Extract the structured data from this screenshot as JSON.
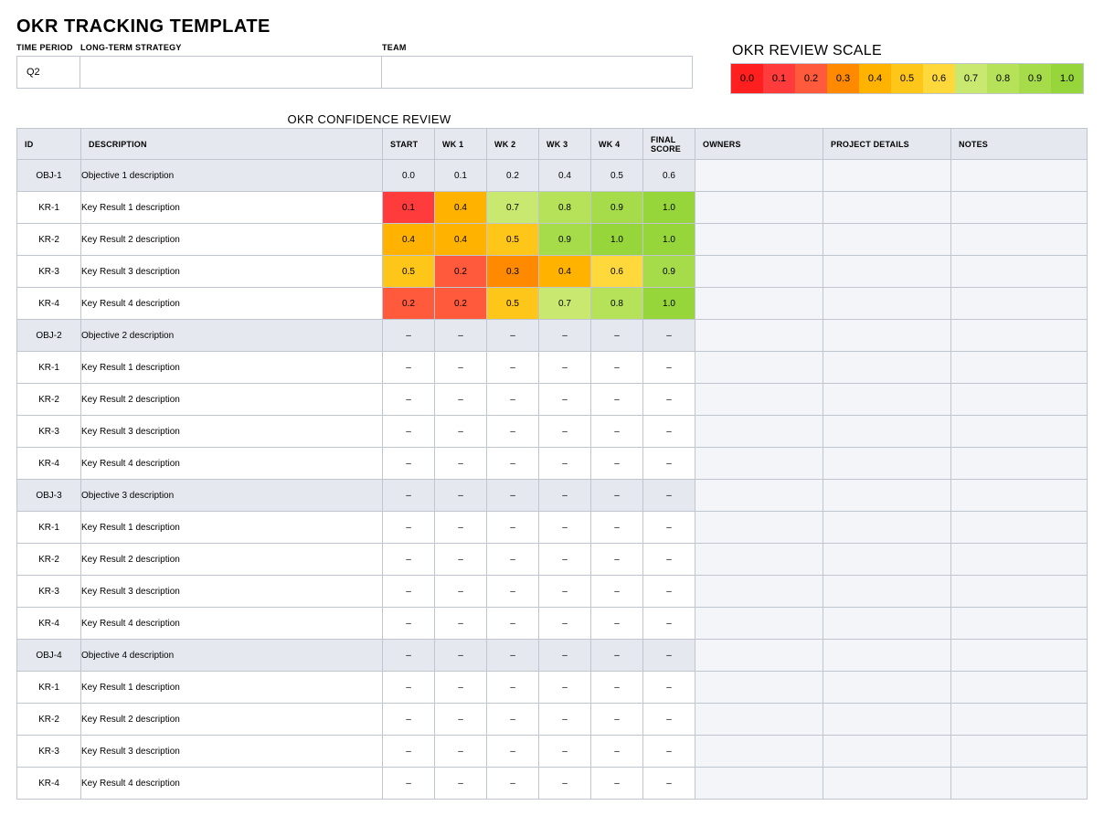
{
  "title": "OKR TRACKING TEMPLATE",
  "meta": {
    "time_period_label": "TIME PERIOD",
    "time_period_value": "Q2",
    "long_term_label": "LONG-TERM STRATEGY",
    "long_term_value": "",
    "team_label": "TEAM",
    "team_value": ""
  },
  "scale": {
    "title": "OKR REVIEW SCALE",
    "cells": [
      "0.0",
      "0.1",
      "0.2",
      "0.3",
      "0.4",
      "0.5",
      "0.6",
      "0.7",
      "0.8",
      "0.9",
      "1.0"
    ]
  },
  "review_title": "OKR CONFIDENCE REVIEW",
  "columns": {
    "id": "ID",
    "description": "DESCRIPTION",
    "start": "START",
    "wk1": "WK 1",
    "wk2": "WK 2",
    "wk3": "WK 3",
    "wk4": "WK 4",
    "final": "FINAL SCORE",
    "owners": "OWNERS",
    "project": "PROJECT DETAILS",
    "notes": "NOTES"
  },
  "rows": [
    {
      "type": "obj",
      "id": "OBJ-1",
      "desc": "Objective 1 description",
      "scores": [
        "0.0",
        "0.1",
        "0.2",
        "0.4",
        "0.5",
        "0.6"
      ]
    },
    {
      "type": "kr",
      "id": "KR-1",
      "desc": "Key Result 1 description",
      "scores": [
        "0.1",
        "0.4",
        "0.7",
        "0.8",
        "0.9",
        "1.0"
      ]
    },
    {
      "type": "kr",
      "id": "KR-2",
      "desc": "Key Result 2 description",
      "scores": [
        "0.4",
        "0.4",
        "0.5",
        "0.9",
        "1.0",
        "1.0"
      ]
    },
    {
      "type": "kr",
      "id": "KR-3",
      "desc": "Key Result 3 description",
      "scores": [
        "0.5",
        "0.2",
        "0.3",
        "0.4",
        "0.6",
        "0.9"
      ]
    },
    {
      "type": "kr",
      "id": "KR-4",
      "desc": "Key Result 4 description",
      "scores": [
        "0.2",
        "0.2",
        "0.5",
        "0.7",
        "0.8",
        "1.0"
      ]
    },
    {
      "type": "obj",
      "id": "OBJ-2",
      "desc": "Objective 2 description",
      "scores": [
        "–",
        "–",
        "–",
        "–",
        "–",
        "–"
      ]
    },
    {
      "type": "kr",
      "id": "KR-1",
      "desc": "Key Result 1 description",
      "scores": [
        "–",
        "–",
        "–",
        "–",
        "–",
        "–"
      ]
    },
    {
      "type": "kr",
      "id": "KR-2",
      "desc": "Key Result 2 description",
      "scores": [
        "–",
        "–",
        "–",
        "–",
        "–",
        "–"
      ]
    },
    {
      "type": "kr",
      "id": "KR-3",
      "desc": "Key Result 3 description",
      "scores": [
        "–",
        "–",
        "–",
        "–",
        "–",
        "–"
      ]
    },
    {
      "type": "kr",
      "id": "KR-4",
      "desc": "Key Result 4 description",
      "scores": [
        "–",
        "–",
        "–",
        "–",
        "–",
        "–"
      ]
    },
    {
      "type": "obj",
      "id": "OBJ-3",
      "desc": "Objective 3 description",
      "scores": [
        "–",
        "–",
        "–",
        "–",
        "–",
        "–"
      ]
    },
    {
      "type": "kr",
      "id": "KR-1",
      "desc": "Key Result 1 description",
      "scores": [
        "–",
        "–",
        "–",
        "–",
        "–",
        "–"
      ]
    },
    {
      "type": "kr",
      "id": "KR-2",
      "desc": "Key Result 2 description",
      "scores": [
        "–",
        "–",
        "–",
        "–",
        "–",
        "–"
      ]
    },
    {
      "type": "kr",
      "id": "KR-3",
      "desc": "Key Result 3 description",
      "scores": [
        "–",
        "–",
        "–",
        "–",
        "–",
        "–"
      ]
    },
    {
      "type": "kr",
      "id": "KR-4",
      "desc": "Key Result 4 description",
      "scores": [
        "–",
        "–",
        "–",
        "–",
        "–",
        "–"
      ]
    },
    {
      "type": "obj",
      "id": "OBJ-4",
      "desc": "Objective 4 description",
      "scores": [
        "–",
        "–",
        "–",
        "–",
        "–",
        "–"
      ]
    },
    {
      "type": "kr",
      "id": "KR-1",
      "desc": "Key Result 1 description",
      "scores": [
        "–",
        "–",
        "–",
        "–",
        "–",
        "–"
      ]
    },
    {
      "type": "kr",
      "id": "KR-2",
      "desc": "Key Result 2 description",
      "scores": [
        "–",
        "–",
        "–",
        "–",
        "–",
        "–"
      ]
    },
    {
      "type": "kr",
      "id": "KR-3",
      "desc": "Key Result 3 description",
      "scores": [
        "–",
        "–",
        "–",
        "–",
        "–",
        "–"
      ]
    },
    {
      "type": "kr",
      "id": "KR-4",
      "desc": "Key Result 4 description",
      "scores": [
        "–",
        "–",
        "–",
        "–",
        "–",
        "–"
      ]
    }
  ]
}
